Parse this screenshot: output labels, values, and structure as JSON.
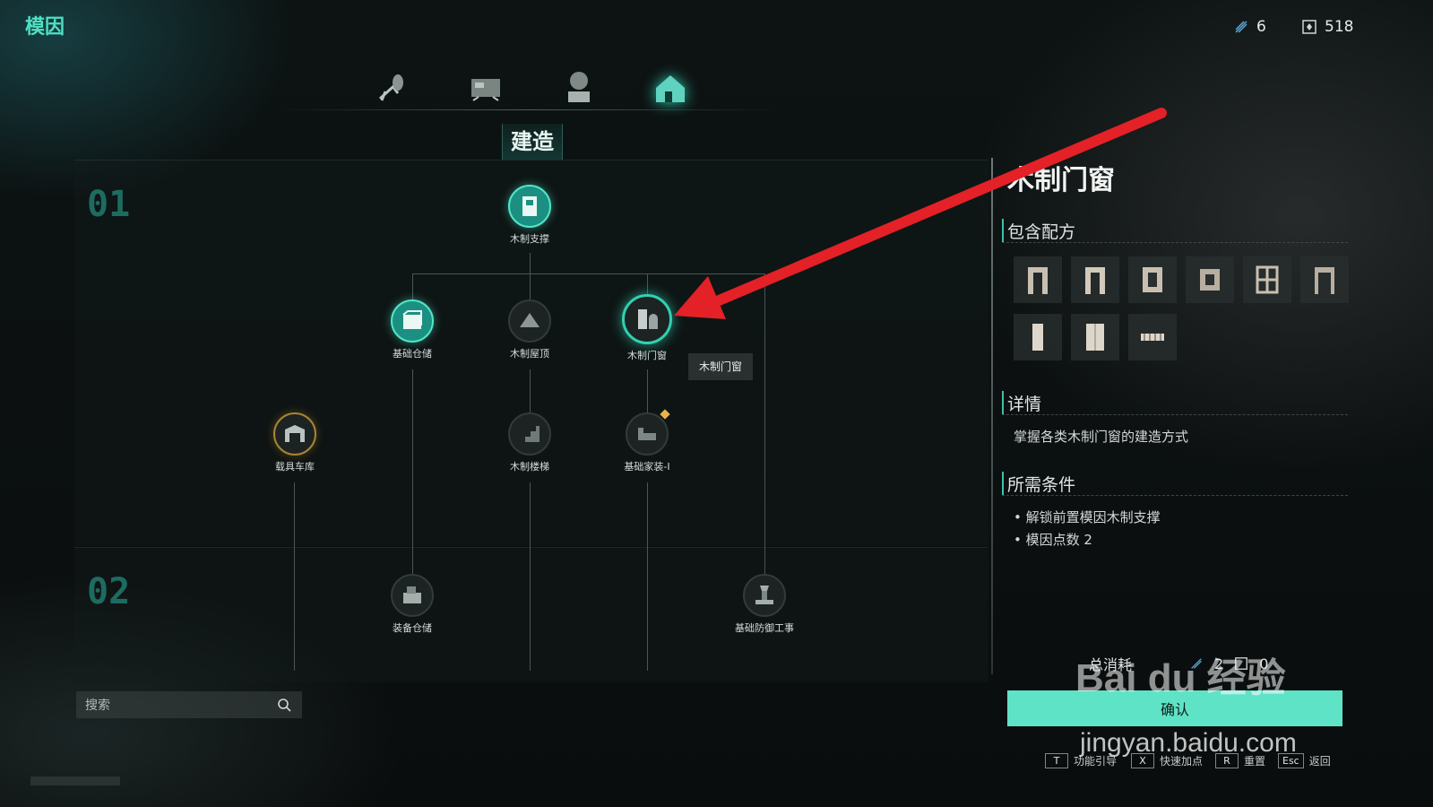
{
  "header": {
    "title": "模因"
  },
  "resources": [
    {
      "name": "gene-points",
      "value": "6"
    },
    {
      "name": "material",
      "value": "518"
    }
  ],
  "categories": [
    {
      "icon": "insect-icon"
    },
    {
      "icon": "workbench-icon"
    },
    {
      "icon": "plant-icon"
    },
    {
      "icon": "house-icon",
      "active": true
    }
  ],
  "section_title": "建造",
  "tiers": [
    "01",
    "02"
  ],
  "nodes": {
    "wood_support": "木制支撑",
    "basic_storage": "基础仓储",
    "wood_roof": "木制屋顶",
    "wood_door_window": "木制门窗",
    "vehicle_garage": "载具车库",
    "wood_stairs": "木制楼梯",
    "basic_furniture": "基础家装-I",
    "equipment_storage": "装备仓储",
    "basic_defense": "基础防御工事"
  },
  "tooltip": "木制门窗",
  "search": {
    "placeholder": "搜索"
  },
  "panel": {
    "title": "木制门窗",
    "recipes_heading": "包含配方",
    "details_heading": "详情",
    "details_text": "掌握各类木制门窗的建造方式",
    "requirements_heading": "所需条件",
    "requirements": [
      "解锁前置模因木制支撑",
      "模因点数 2"
    ]
  },
  "cost": {
    "label": "总消耗",
    "gene_points": "2",
    "material": "0"
  },
  "confirm_label": "确认",
  "hints": [
    {
      "key": "T",
      "label": "功能引导"
    },
    {
      "key": "X",
      "label": "快速加点"
    },
    {
      "key": "R",
      "label": "重置"
    },
    {
      "key": "Esc",
      "label": "返回"
    }
  ],
  "watermark": {
    "logo": "Bai du 经验",
    "url": "jingyan.baidu.com"
  }
}
